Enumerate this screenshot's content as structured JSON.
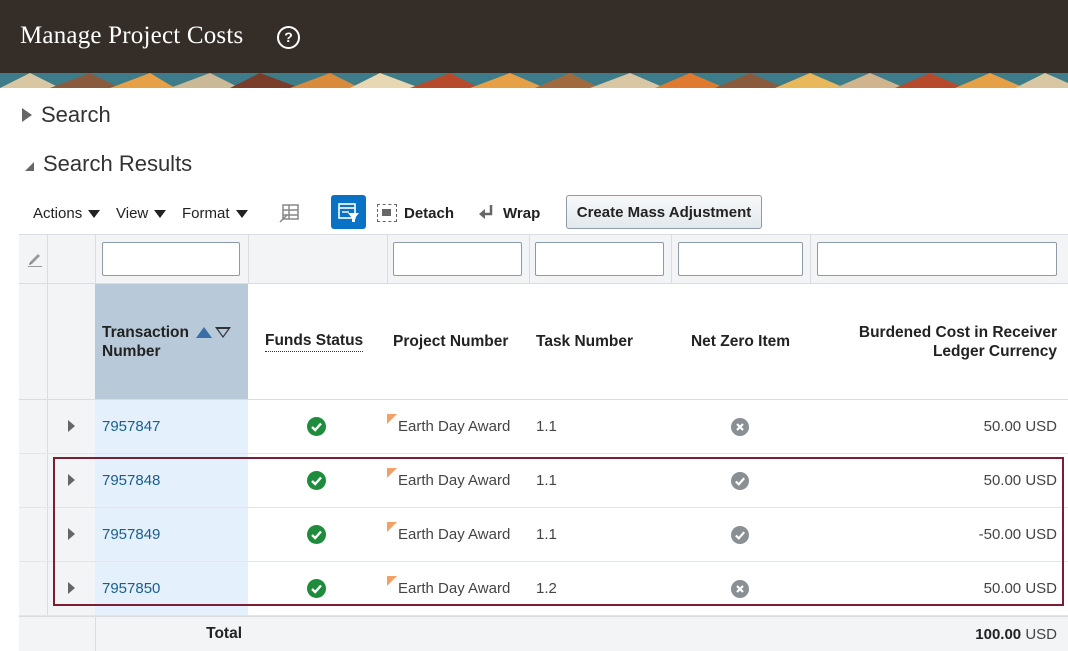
{
  "header": {
    "title": "Manage Project Costs",
    "help_icon": "help-circle-icon"
  },
  "sections": {
    "search": "Search",
    "results": "Search Results"
  },
  "toolbar": {
    "actions": "Actions",
    "view": "View",
    "format": "Format",
    "detach": "Detach",
    "wrap": "Wrap",
    "mass_adjustment": "Create Mass Adjustment"
  },
  "columns": {
    "transaction_line1": "Transaction",
    "transaction_line2": "Number",
    "funds_status": "Funds Status",
    "project_number": "Project Number",
    "task_number": "Task Number",
    "net_zero": "Net Zero Item",
    "burdened_line1": "Burdened Cost in Receiver",
    "burdened_line2": "Ledger Currency"
  },
  "rows": [
    {
      "transaction": "7957847",
      "funds_status": "check",
      "project": "Earth Day Award",
      "task": "1.1",
      "net_zero": "x",
      "amount": "50.00",
      "currency": "USD"
    },
    {
      "transaction": "7957848",
      "funds_status": "check",
      "project": "Earth Day Award",
      "task": "1.1",
      "net_zero": "check",
      "amount": "50.00",
      "currency": "USD"
    },
    {
      "transaction": "7957849",
      "funds_status": "check",
      "project": "Earth Day Award",
      "task": "1.1",
      "net_zero": "check",
      "amount": "-50.00",
      "currency": "USD"
    },
    {
      "transaction": "7957850",
      "funds_status": "check",
      "project": "Earth Day Award",
      "task": "1.2",
      "net_zero": "x",
      "amount": "50.00",
      "currency": "USD"
    }
  ],
  "total": {
    "label": "Total",
    "amount": "100.00",
    "currency": "USD"
  },
  "colors": {
    "header_bg": "#352e28",
    "accent": "#0a72c5",
    "link": "#1a5f8c",
    "success": "#1e8c3c",
    "highlight_border": "#7a1f33",
    "sorted_header": "#b8cad9",
    "sorted_column": "#e4f0fb"
  }
}
